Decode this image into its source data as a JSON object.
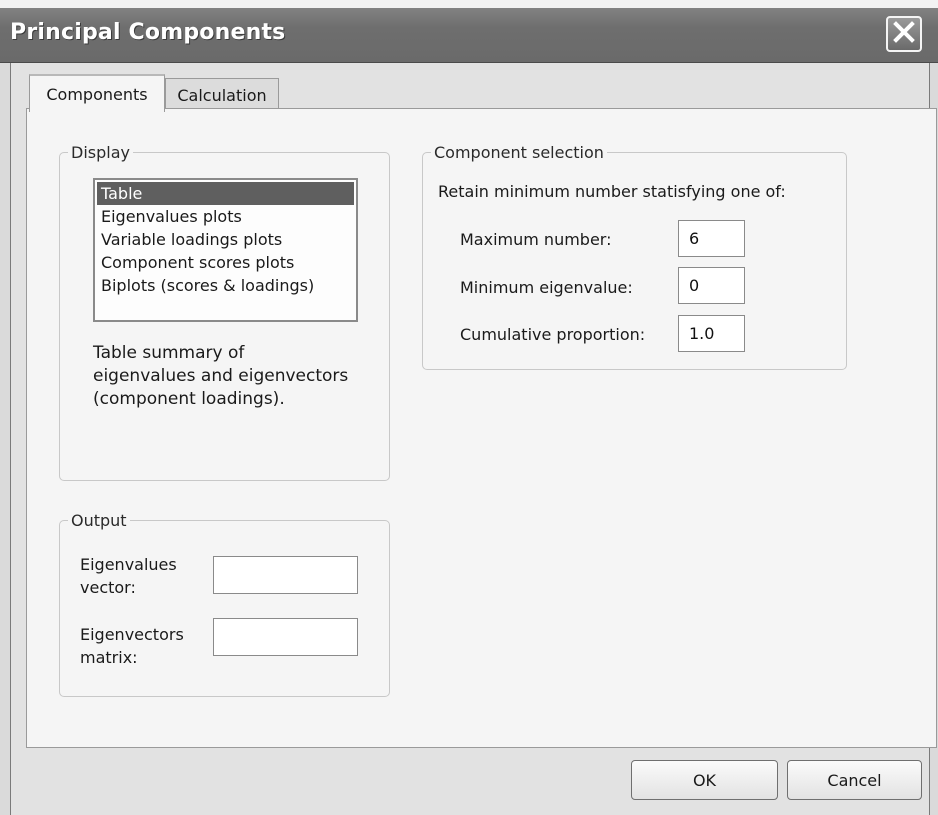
{
  "window": {
    "title": "Principal Components"
  },
  "tabs": [
    {
      "label": "Components",
      "active": true
    },
    {
      "label": "Calculation",
      "active": false
    }
  ],
  "display": {
    "legend": "Display",
    "list_items": [
      {
        "label": "Table",
        "selected": true
      },
      {
        "label": "Eigenvalues plots",
        "selected": false
      },
      {
        "label": "Variable loadings plots",
        "selected": false
      },
      {
        "label": "Component scores plots",
        "selected": false
      },
      {
        "label": "Biplots (scores & loadings)",
        "selected": false
      }
    ],
    "description_lines": [
      "Table summary of",
      "eigenvalues and eigenvectors",
      "(component loadings)."
    ]
  },
  "output": {
    "legend": "Output",
    "eigenvalues_label_lines": [
      "Eigenvalues",
      "vector:"
    ],
    "eigenvalues_value": "",
    "eigenvectors_label_lines": [
      "Eigenvectors",
      "matrix:"
    ],
    "eigenvectors_value": ""
  },
  "component_selection": {
    "legend": "Component selection",
    "retain_text": "Retain minimum number statisfying one of:",
    "max_number_label": "Maximum number:",
    "max_number_value": "6",
    "min_eigenvalue_label": "Minimum eigenvalue:",
    "min_eigenvalue_value": "0",
    "cumulative_label": "Cumulative proportion:",
    "cumulative_value": "1.0"
  },
  "buttons": {
    "ok": "OK",
    "cancel": "Cancel"
  },
  "icons": {
    "close": "close-icon"
  }
}
